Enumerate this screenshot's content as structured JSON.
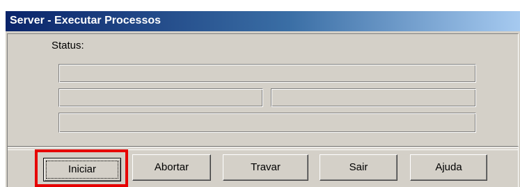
{
  "window": {
    "title": "Server - Executar Processos"
  },
  "status": {
    "label": "Status:",
    "fields": [
      "",
      "",
      "",
      ""
    ]
  },
  "buttons": {
    "iniciar": "Iniciar",
    "abortar": "Abortar",
    "travar": "Travar",
    "sair": "Sair",
    "ajuda": "Ajuda"
  },
  "colors": {
    "titlebar_start": "#0a246a",
    "titlebar_end": "#a6caf0",
    "dialog_face": "#d4d0c8",
    "highlight": "#e60000"
  }
}
